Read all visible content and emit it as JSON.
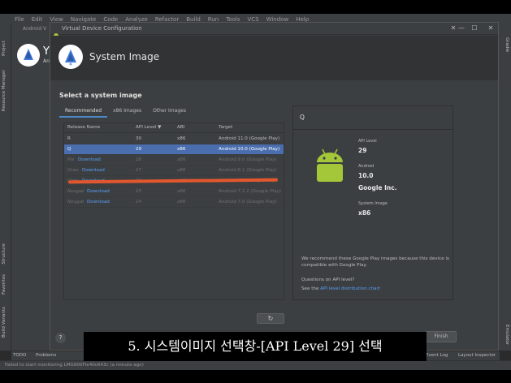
{
  "ide": {
    "menu": [
      "File",
      "Edit",
      "View",
      "Navigate",
      "Code",
      "Analyze",
      "Refactor",
      "Build",
      "Run",
      "Tools",
      "VCS",
      "Window",
      "Help"
    ],
    "bg_tab": "Android V",
    "left_tabs": [
      "Project",
      "Resource Manager",
      "Structure",
      "Favorites",
      "Build Variants"
    ],
    "right_tabs": [
      "Gradle",
      "Emulator"
    ],
    "bg_letter": "Y",
    "bg_sub": "An"
  },
  "dialog": {
    "title": "Virtual Device Configuration",
    "header_title": "System Image",
    "section_title": "Select a system image",
    "tabs": [
      {
        "label": "Recommended",
        "active": true
      },
      {
        "label": "x86 Images",
        "active": false
      },
      {
        "label": "Other Images",
        "active": false
      }
    ],
    "columns": [
      "Release Name",
      "API Level ▼",
      "ABI",
      "Target"
    ],
    "rows": [
      {
        "name": "R",
        "download": "",
        "api": "30",
        "abi": "x86",
        "target": "Android 11.0 (Google Play)",
        "state": "normal"
      },
      {
        "name": "Q",
        "download": "",
        "api": "29",
        "abi": "x86",
        "target": "Android 10.0 (Google Play)",
        "state": "selected"
      },
      {
        "name": "Pie",
        "download": "Download",
        "api": "28",
        "abi": "x86",
        "target": "Android 9.0 (Google Play)",
        "state": "dim"
      },
      {
        "name": "Oreo",
        "download": "Download",
        "api": "27",
        "abi": "x86",
        "target": "Android 8.1 (Google Play)",
        "state": "dim"
      },
      {
        "name": "Oreo",
        "download": "Download",
        "api": "26",
        "abi": "x86",
        "target": "Android 8.0 (Google Play)",
        "state": "dim"
      },
      {
        "name": "Nougat",
        "download": "Download",
        "api": "25",
        "abi": "x86",
        "target": "Android 7.1.1 (Google Play)",
        "state": "dim"
      },
      {
        "name": "Nougat",
        "download": "Download",
        "api": "24",
        "abi": "x86",
        "target": "Android 7.0 (Google Play)",
        "state": "dim"
      }
    ],
    "refresh_icon": "↻",
    "detail": {
      "name": "Q",
      "api_label": "API Level",
      "api_value": "29",
      "android_label": "Android",
      "android_value": "10.0",
      "vendor_value": "Google Inc.",
      "sysimg_label": "System Image",
      "sysimg_value": "x86",
      "recommend_text": "We recommend these Google Play images because this device is compatible with Google Play.",
      "questions": "Questions on API level?",
      "see_prefix": "See the ",
      "see_link": "API level distribution chart"
    },
    "help_label": "?",
    "finish_label": "Finish",
    "win_controls": {
      "min": "—",
      "max": "☐",
      "close": "✕"
    }
  },
  "bottom_bar": {
    "todo": "TODO",
    "problems": "Problems",
    "event_log": "Event Log",
    "layout_inspector": "Layout Inspector"
  },
  "status_bar": {
    "text": "Failed to start monitoring LMG900Fle40c643c (a minute ago)"
  },
  "subtitle": "5. 시스템이미지 선택창-[API Level 29] 선택",
  "colors": {
    "accent": "#4b6eaf",
    "link": "#589df6",
    "annotation": "#e4572e",
    "android_green": "#a4c639"
  }
}
